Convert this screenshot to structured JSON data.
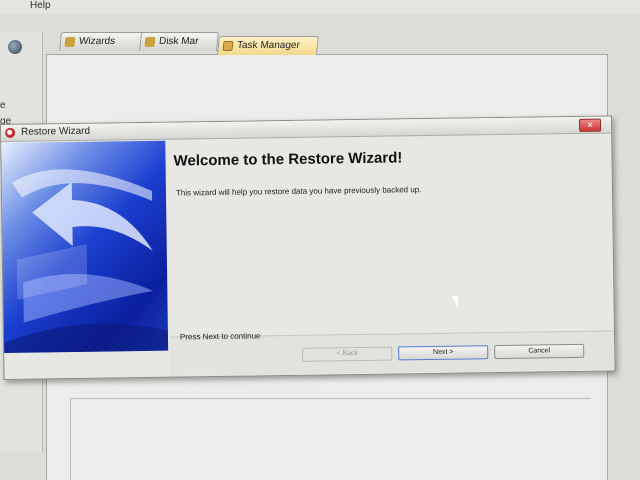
{
  "menubar": {
    "help_label": "Help"
  },
  "left_pane": {
    "frag1": "e",
    "frag2": "ge"
  },
  "tabs": [
    {
      "label": "Wizards",
      "icon": "wand-icon"
    },
    {
      "label": "Disk Mar",
      "icon": "disk-icon"
    },
    {
      "label": "Task Manager",
      "icon": "task-icon"
    }
  ],
  "dialog": {
    "title": "Restore Wizard",
    "heading": "Welcome to the Restore Wizard!",
    "description": "This wizard will help you restore data you have previously backed up.",
    "press_next": "Press Next to continue",
    "buttons": {
      "back": "< Back",
      "next": "Next >",
      "cancel": "Cancel"
    },
    "close_symbol": "✕"
  },
  "colors": {
    "banner_blue": "#1c3fd0",
    "close_red": "#c33"
  }
}
